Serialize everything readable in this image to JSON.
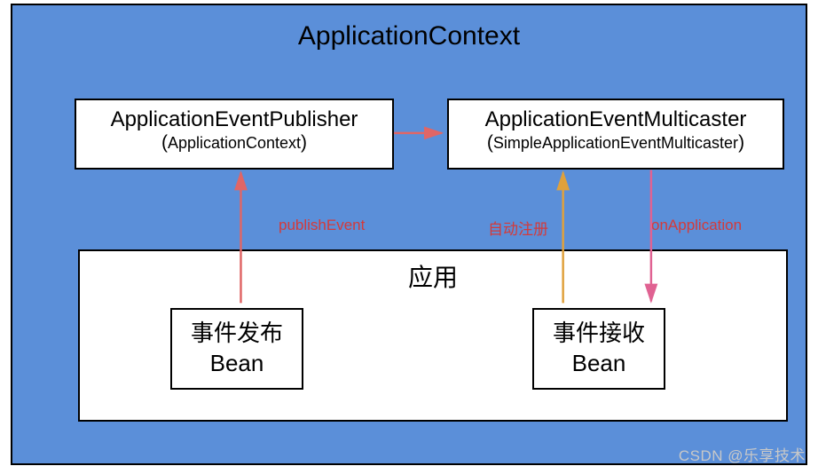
{
  "title": "ApplicationContext",
  "publisher": {
    "name": "ApplicationEventPublisher",
    "impl": "ApplicationContext"
  },
  "multicaster": {
    "name": "ApplicationEventMulticaster",
    "impl": "SimpleApplicationEventMulticaster"
  },
  "app": {
    "title": "应用",
    "pub_bean_line1": "事件发布",
    "pub_bean_line2": "Bean",
    "recv_bean_line1": "事件接收",
    "recv_bean_line2": "Bean"
  },
  "labels": {
    "publishEvent": "publishEvent",
    "autoRegister": "自动注册",
    "onApplication": "onApplication"
  },
  "watermark": "CSDN @乐享技术"
}
